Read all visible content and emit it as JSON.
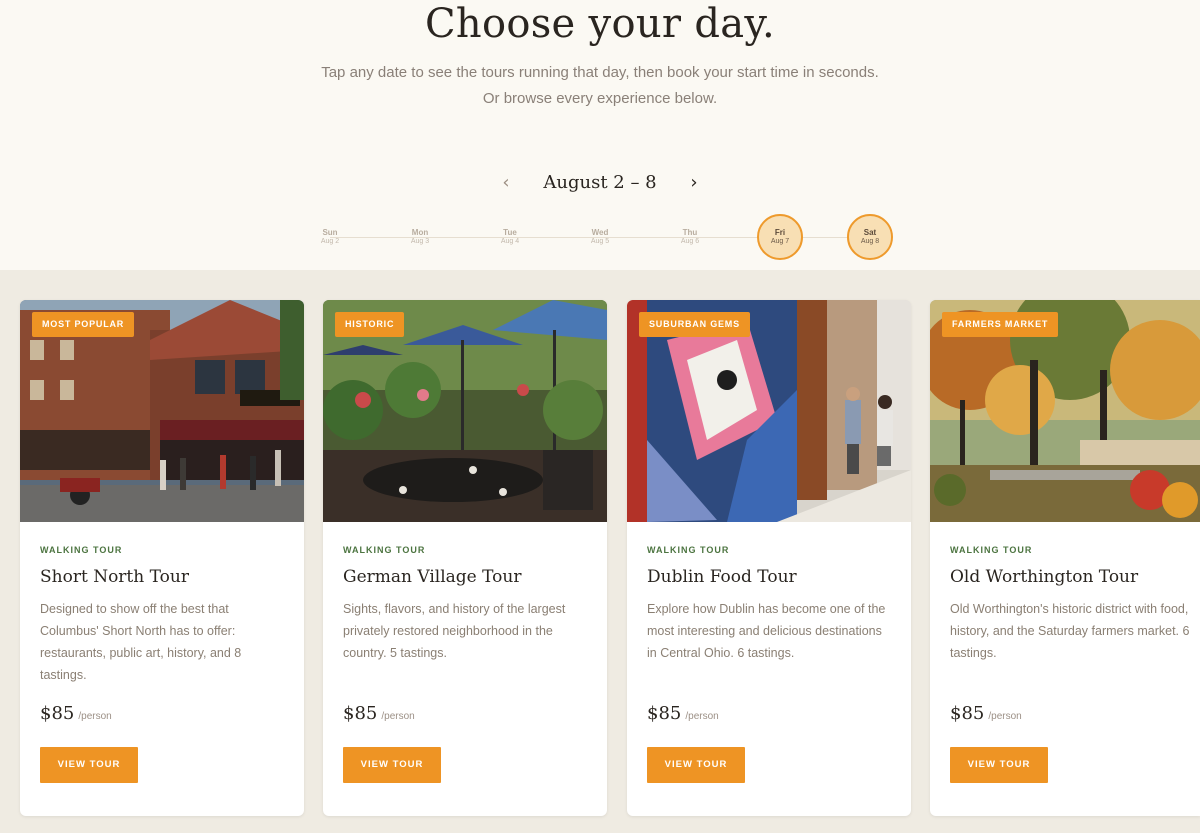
{
  "hero": {
    "title": "Choose your day.",
    "subtitle_line1": "Tap any date to see the tours running that day, then book your start time in seconds.",
    "subtitle_line2": "Or browse every experience below."
  },
  "week": {
    "prev_icon": "‹",
    "label": "August 2 – 8",
    "next_icon": "›",
    "days": [
      {
        "name": "Sun",
        "date": "Aug 2",
        "available": false
      },
      {
        "name": "Mon",
        "date": "Aug 3",
        "available": false
      },
      {
        "name": "Tue",
        "date": "Aug 4",
        "available": false
      },
      {
        "name": "Wed",
        "date": "Aug 5",
        "available": false
      },
      {
        "name": "Thu",
        "date": "Aug 6",
        "available": false
      },
      {
        "name": "Fri",
        "date": "Aug 7",
        "available": true
      },
      {
        "name": "Sat",
        "date": "Aug 8",
        "available": true
      }
    ]
  },
  "colors": {
    "accent": "#ee9424",
    "kicker": "#4c7440",
    "background": "#fbf9f3",
    "cards_background": "#efebe2"
  },
  "tours": [
    {
      "badge": "MOST POPULAR",
      "kicker": "WALKING TOUR",
      "title": "Short North Tour",
      "description": "Designed to show off the best that Columbus' Short North has to offer: restaurants, public art, history, and 8 tastings.",
      "price": "$85",
      "per": "/person",
      "button": "VIEW TOUR",
      "image": "street-photo"
    },
    {
      "badge": "HISTORIC",
      "kicker": "WALKING TOUR",
      "title": "German Village Tour",
      "description": "Sights, flavors, and history of the largest privately restored neighborhood in the country. 5 tastings.",
      "price": "$85",
      "per": "/person",
      "button": "VIEW TOUR",
      "image": "patio-photo"
    },
    {
      "badge": "SUBURBAN GEMS",
      "kicker": "WALKING TOUR",
      "title": "Dublin Food Tour",
      "description": "Explore how Dublin has become one of the most interesting and delicious destinations in Central Ohio. 6 tastings.",
      "price": "$85",
      "per": "/person",
      "button": "VIEW TOUR",
      "image": "mural-photo"
    },
    {
      "badge": "FARMERS MARKET",
      "kicker": "WALKING TOUR",
      "title": "Old Worthington Tour",
      "description": "Old Worthington's historic district with food, history, and the Saturday farmers market. 6 tastings.",
      "price": "$85",
      "per": "/person",
      "button": "VIEW TOUR",
      "image": "trees-photo"
    }
  ]
}
